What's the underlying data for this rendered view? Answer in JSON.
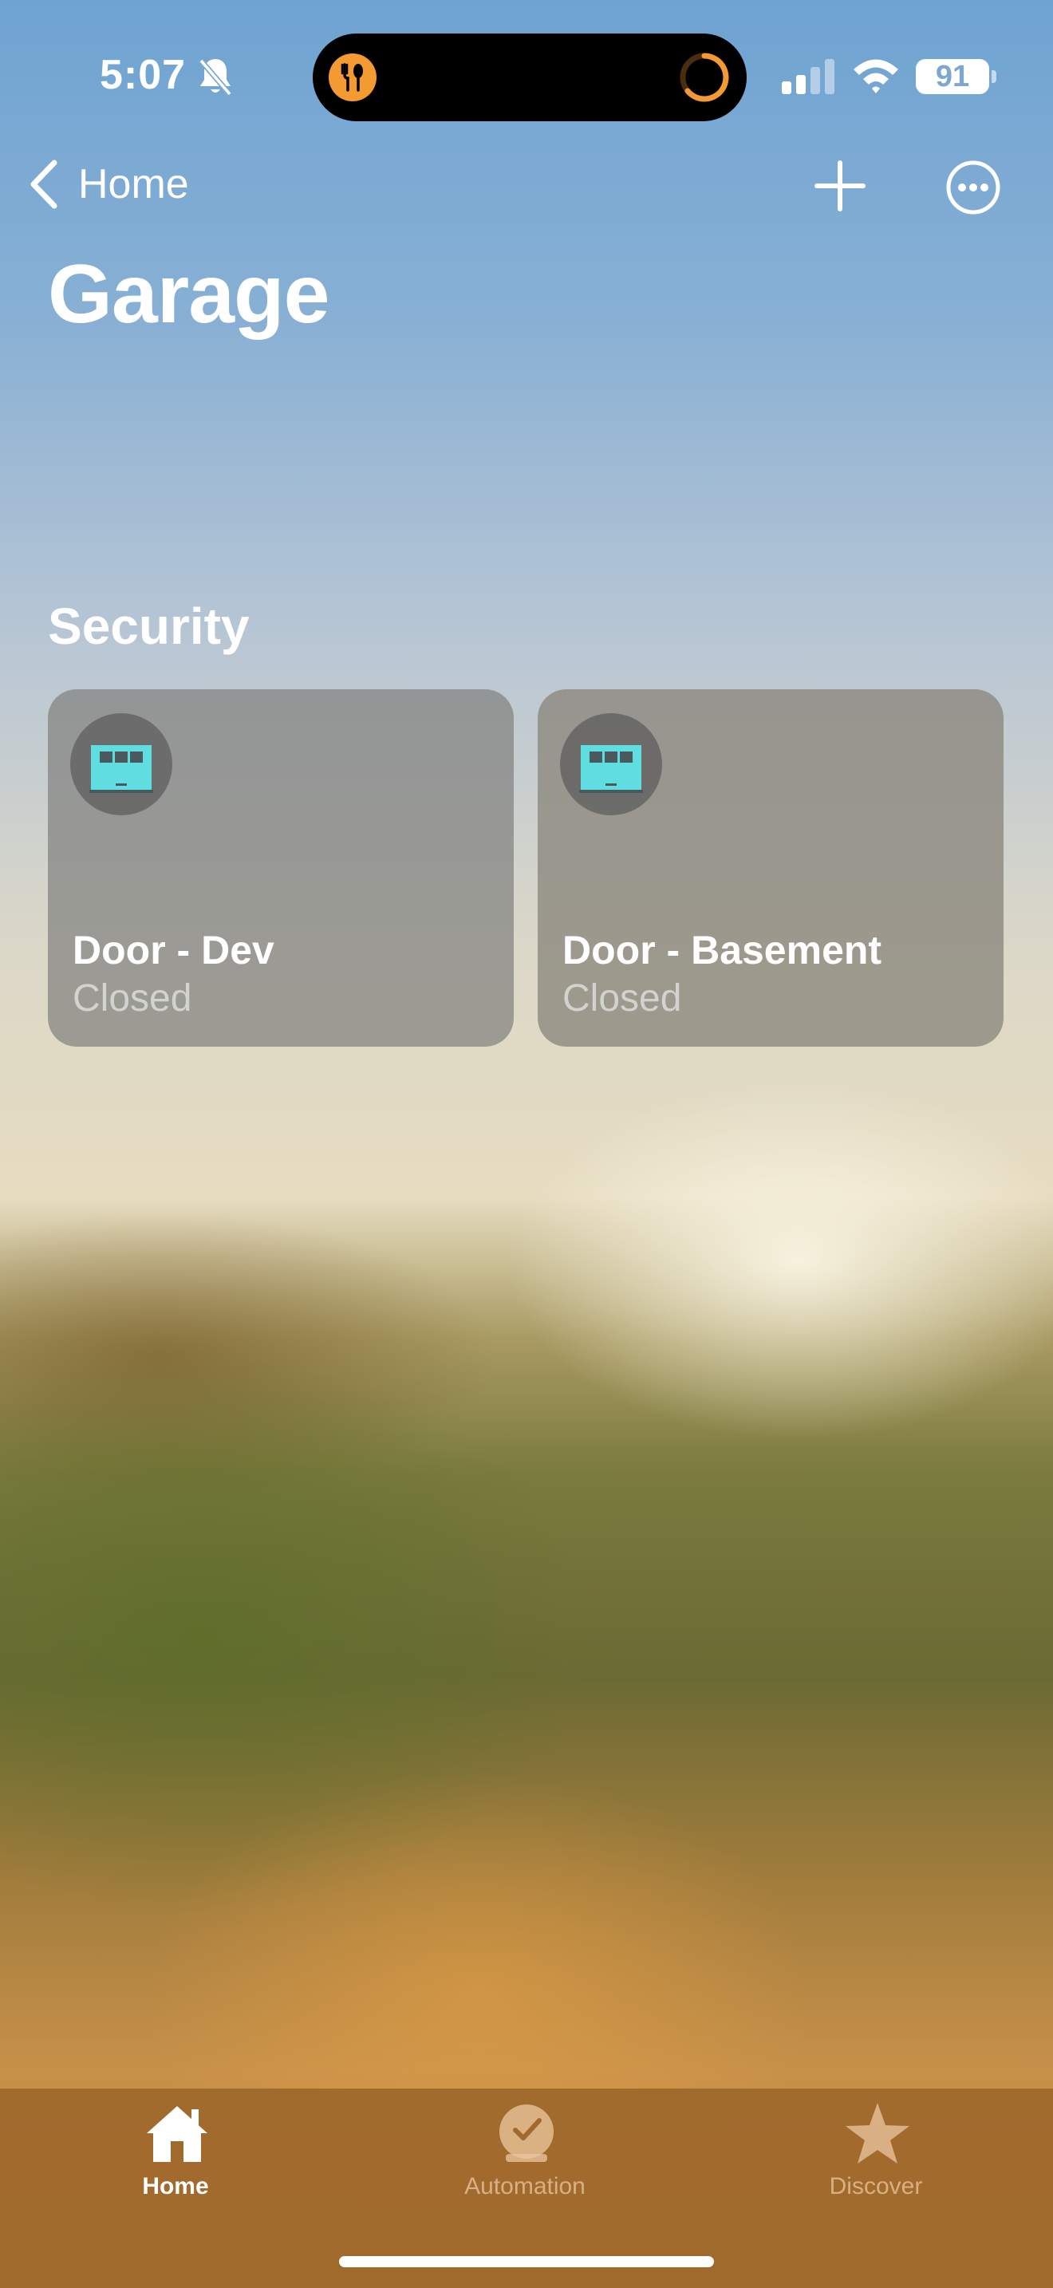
{
  "status_bar": {
    "time": "5:07",
    "battery": "91",
    "icons": [
      "bell-slash-icon",
      "food-icon",
      "activity-ring-icon",
      "cellular-signal-icon",
      "wifi-icon",
      "battery-icon"
    ],
    "food_icon_color": "#f39b32"
  },
  "navigation": {
    "back_label": "Home",
    "icons": [
      "chevron-left-icon",
      "plus-icon",
      "more-icon"
    ]
  },
  "page": {
    "title": "Garage"
  },
  "section": {
    "title": "Security"
  },
  "accessories": [
    {
      "name": "Door - Dev",
      "status": "Closed",
      "icon": "garage-door-icon"
    },
    {
      "name": "Door - Basement",
      "status": "Closed",
      "icon": "garage-door-icon"
    }
  ],
  "colors": {
    "accent": "#5fdde0"
  },
  "tab_bar": {
    "tabs": [
      {
        "label": "Home",
        "icon": "house-icon",
        "selected": true
      },
      {
        "label": "Automation",
        "icon": "clock-check-icon",
        "selected": false
      },
      {
        "label": "Discover",
        "icon": "star-icon",
        "selected": false
      }
    ]
  }
}
